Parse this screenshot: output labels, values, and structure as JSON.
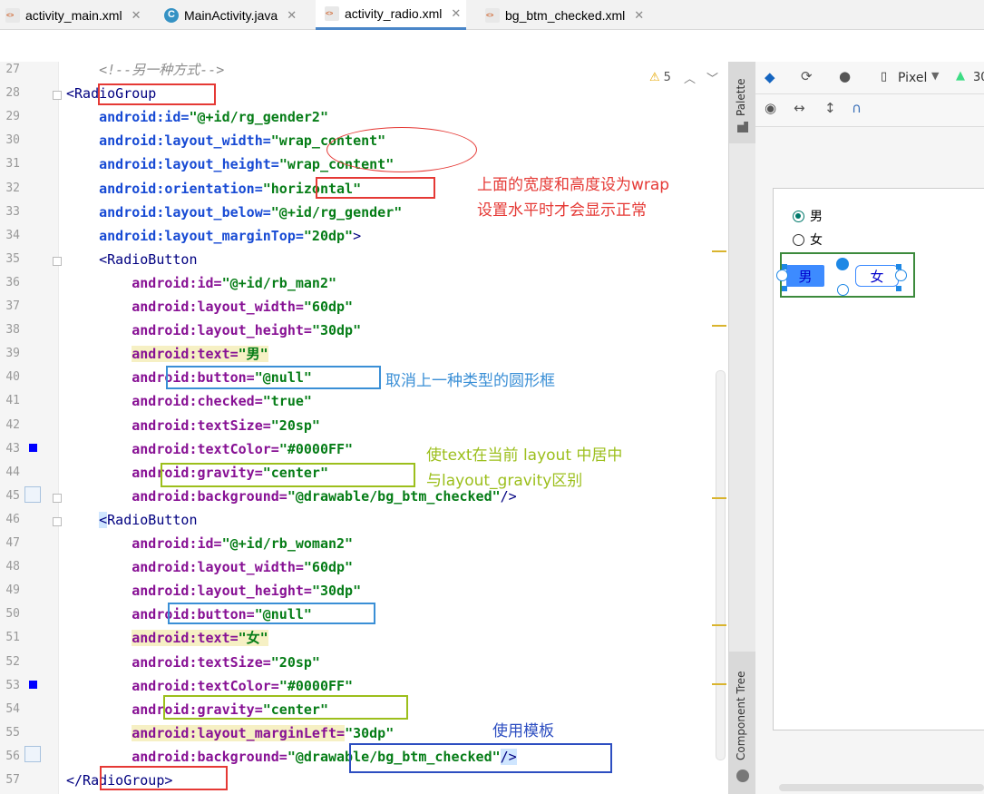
{
  "tabs": [
    {
      "label": "activity_main.xml",
      "icon": "xml-file-icon"
    },
    {
      "label": "MainActivity.java",
      "icon": "java-class-icon"
    },
    {
      "label": "activity_radio.xml",
      "icon": "xml-file-icon",
      "active": true
    },
    {
      "label": "bg_btm_checked.xml",
      "icon": "xml-file-icon"
    }
  ],
  "warnings": {
    "count": "5"
  },
  "code": {
    "lines": [
      {
        "n": "27",
        "segments": [
          {
            "t": "    ",
            "c": ""
          },
          {
            "t": "<!--另一种方式-->",
            "c": "cmt"
          }
        ]
      },
      {
        "n": "28",
        "segments": [
          {
            "t": "<",
            "c": "tag"
          },
          {
            "t": "RadioGroup",
            "c": "tag"
          }
        ]
      },
      {
        "n": "29",
        "segments": [
          {
            "t": "    android:id=",
            "c": "attr"
          },
          {
            "t": "\"@+id/rg_gender2\"",
            "c": "str"
          }
        ]
      },
      {
        "n": "30",
        "segments": [
          {
            "t": "    android:layout_width=",
            "c": "attr"
          },
          {
            "t": "\"wrap_content\"",
            "c": "str"
          }
        ]
      },
      {
        "n": "31",
        "segments": [
          {
            "t": "    android:layout_height=",
            "c": "attr"
          },
          {
            "t": "\"wrap_content\"",
            "c": "str"
          }
        ]
      },
      {
        "n": "32",
        "segments": [
          {
            "t": "    android:orientation=",
            "c": "attr"
          },
          {
            "t": "\"horizontal\"",
            "c": "str"
          }
        ]
      },
      {
        "n": "33",
        "segments": [
          {
            "t": "    android:layout_below=",
            "c": "attr"
          },
          {
            "t": "\"@+id/rg_gender\"",
            "c": "str"
          }
        ]
      },
      {
        "n": "34",
        "segments": [
          {
            "t": "    android:layout_marginTop=",
            "c": "attr"
          },
          {
            "t": "\"20dp\"",
            "c": "str"
          },
          {
            "t": ">",
            "c": "tag"
          }
        ]
      },
      {
        "n": "35",
        "segments": [
          {
            "t": "    <RadioButton",
            "c": "tag"
          }
        ]
      },
      {
        "n": "36",
        "segments": [
          {
            "t": "        android:id=",
            "c": "attr dk"
          },
          {
            "t": "\"@+id/rb_man2\"",
            "c": "str"
          }
        ]
      },
      {
        "n": "37",
        "segments": [
          {
            "t": "        android:layout_width=",
            "c": "attr dk"
          },
          {
            "t": "\"60dp\"",
            "c": "str"
          }
        ]
      },
      {
        "n": "38",
        "segments": [
          {
            "t": "        android:layout_height=",
            "c": "attr dk"
          },
          {
            "t": "\"30dp\"",
            "c": "str"
          }
        ]
      },
      {
        "n": "39",
        "segments": [
          {
            "t": "        ",
            "c": ""
          },
          {
            "t": "android:text=",
            "c": "attr dk hl"
          },
          {
            "t": "\"男\"",
            "c": "str hl"
          }
        ]
      },
      {
        "n": "40",
        "segments": [
          {
            "t": "        android:button=",
            "c": "attr dk"
          },
          {
            "t": "\"@null\"",
            "c": "str"
          }
        ]
      },
      {
        "n": "41",
        "segments": [
          {
            "t": "        android:checked=",
            "c": "attr dk"
          },
          {
            "t": "\"true\"",
            "c": "str"
          }
        ]
      },
      {
        "n": "42",
        "segments": [
          {
            "t": "        android:textSize=",
            "c": "attr dk"
          },
          {
            "t": "\"20sp\"",
            "c": "str"
          }
        ]
      },
      {
        "n": "43",
        "segments": [
          {
            "t": "        android:textColor=",
            "c": "attr dk"
          },
          {
            "t": "\"#0000FF\"",
            "c": "str"
          }
        ]
      },
      {
        "n": "44",
        "segments": [
          {
            "t": "        android:gravity=",
            "c": "attr dk"
          },
          {
            "t": "\"center\"",
            "c": "str"
          }
        ]
      },
      {
        "n": "45",
        "segments": [
          {
            "t": "        android:background=",
            "c": "attr dk"
          },
          {
            "t": "\"@drawable/bg_btm_checked\"",
            "c": "str"
          },
          {
            "t": "/>",
            "c": "tag"
          }
        ]
      },
      {
        "n": "46",
        "segments": [
          {
            "t": "    ",
            "c": ""
          },
          {
            "t": "<",
            "c": "tag hl2"
          },
          {
            "t": "RadioButton",
            "c": "tag"
          }
        ]
      },
      {
        "n": "47",
        "segments": [
          {
            "t": "        android:id=",
            "c": "attr dk"
          },
          {
            "t": "\"@+id/rb_woman2\"",
            "c": "str"
          }
        ]
      },
      {
        "n": "48",
        "segments": [
          {
            "t": "        android:layout_width=",
            "c": "attr dk"
          },
          {
            "t": "\"60dp\"",
            "c": "str"
          }
        ]
      },
      {
        "n": "49",
        "segments": [
          {
            "t": "        android:layout_height=",
            "c": "attr dk"
          },
          {
            "t": "\"30dp\"",
            "c": "str"
          }
        ]
      },
      {
        "n": "50",
        "segments": [
          {
            "t": "        android:button=",
            "c": "attr dk"
          },
          {
            "t": "\"@null\"",
            "c": "str"
          }
        ]
      },
      {
        "n": "51",
        "segments": [
          {
            "t": "        ",
            "c": ""
          },
          {
            "t": "android:text=",
            "c": "attr dk hl"
          },
          {
            "t": "\"女\"",
            "c": "str hl"
          }
        ]
      },
      {
        "n": "52",
        "segments": [
          {
            "t": "        android:textSize=",
            "c": "attr dk"
          },
          {
            "t": "\"20sp\"",
            "c": "str"
          }
        ]
      },
      {
        "n": "53",
        "segments": [
          {
            "t": "        android:textColor=",
            "c": "attr dk"
          },
          {
            "t": "\"#0000FF\"",
            "c": "str"
          }
        ]
      },
      {
        "n": "54",
        "segments": [
          {
            "t": "        android:gravity=",
            "c": "attr dk"
          },
          {
            "t": "\"center\"",
            "c": "str"
          }
        ]
      },
      {
        "n": "55",
        "segments": [
          {
            "t": "        ",
            "c": ""
          },
          {
            "t": "android:layout_marginLeft=",
            "c": "attr dk hl"
          },
          {
            "t": "\"30dp\"",
            "c": "str"
          }
        ]
      },
      {
        "n": "56",
        "segments": [
          {
            "t": "        android:background=",
            "c": "attr dk"
          },
          {
            "t": "\"@drawable/bg_btm_checked\"",
            "c": "str"
          },
          {
            "t": "/>",
            "c": "tag hl2"
          }
        ]
      },
      {
        "n": "57",
        "segments": [
          {
            "t": "</RadioGroup>",
            "c": "tag"
          }
        ]
      }
    ]
  },
  "annotations": {
    "wrap_note_1": "上面的宽度和高度设为wrap",
    "wrap_note_2": "设置水平时才会显示正常",
    "button_note": "取消上一种类型的圆形框",
    "gravity_note_1": "使text在当前 layout 中居中",
    "gravity_note_2": "与layout_gravity区别",
    "template_note": "使用模板"
  },
  "side_panels": {
    "palette": "Palette",
    "component_tree": "Component Tree"
  },
  "design": {
    "device_label": "Pixel",
    "api_label": "30",
    "radio1": {
      "label": "男",
      "checked": true
    },
    "radio2": {
      "label": "女",
      "checked": false
    },
    "btn_man": "男",
    "btn_woman": "女"
  },
  "colors": {
    "red_box": "#e53935",
    "blue_box": "#3a8fd6",
    "green_box": "#9cbf1c",
    "dark_blue_box": "#2d4ec1",
    "design_green": "#3c8a3c"
  }
}
